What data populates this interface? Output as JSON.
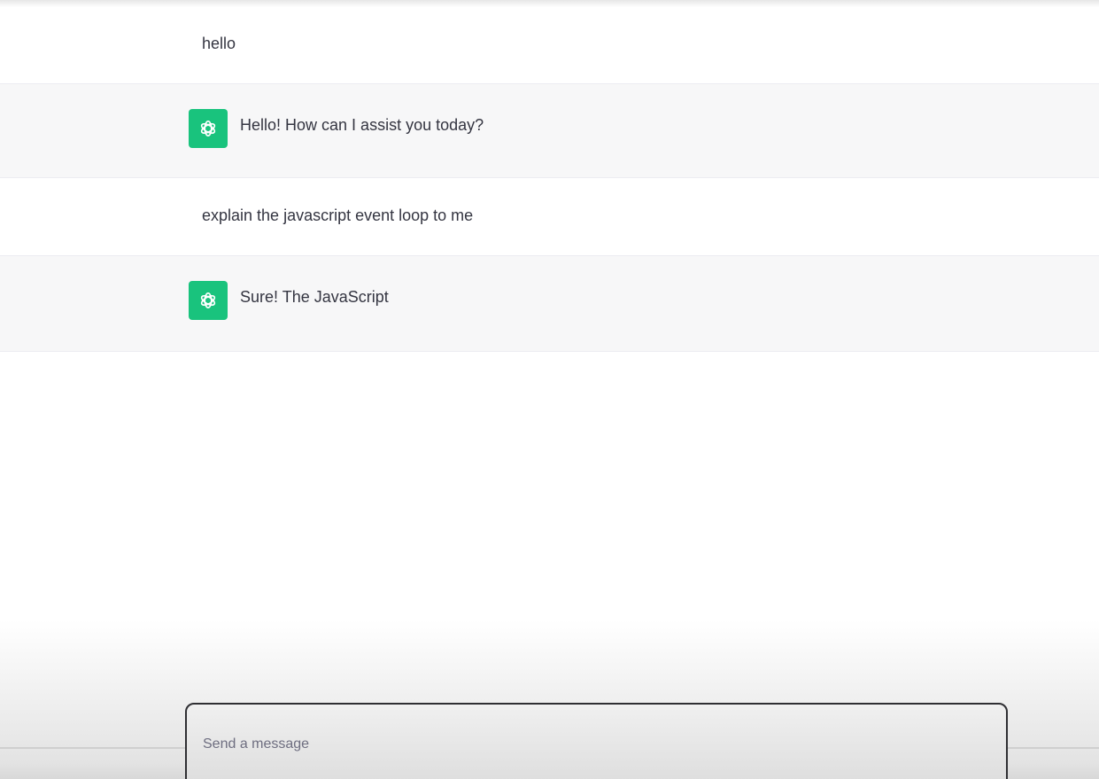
{
  "conversation": {
    "messages": [
      {
        "role": "user",
        "text": "hello"
      },
      {
        "role": "assistant",
        "text": "Hello! How can I assist you today?"
      },
      {
        "role": "user",
        "text": "explain the javascript event loop to me"
      },
      {
        "role": "assistant",
        "text": "Sure! The JavaScript"
      }
    ]
  },
  "composer": {
    "placeholder": "Send a message",
    "value": ""
  },
  "icons": {
    "assistant_avatar": "openai-logo-icon"
  },
  "colors": {
    "avatar_bg": "#19c37d",
    "assistant_row_bg": "#f7f7f8",
    "text": "#343541"
  }
}
